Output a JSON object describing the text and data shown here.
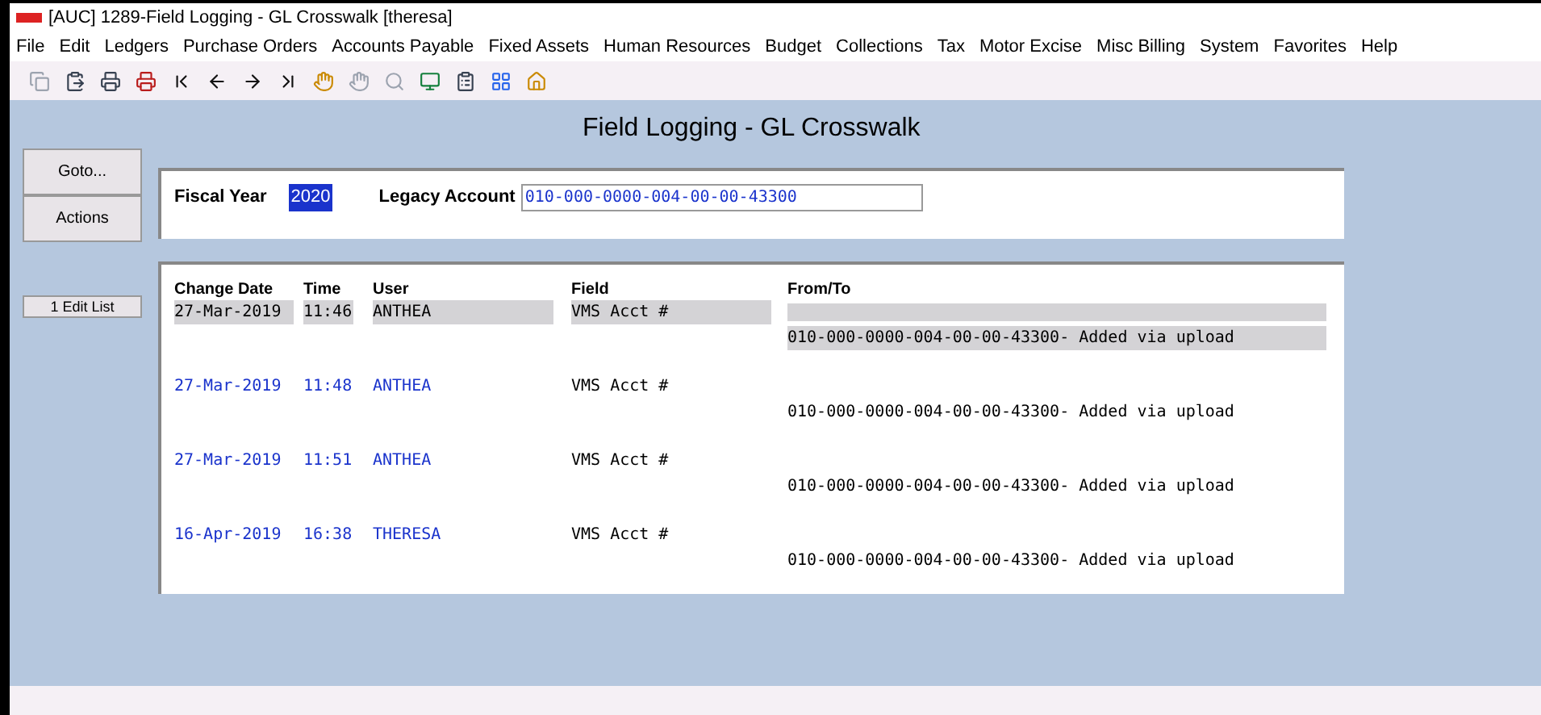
{
  "window": {
    "title": "[AUC] 1289-Field Logging - GL Crosswalk [theresa]"
  },
  "menu": [
    "File",
    "Edit",
    "Ledgers",
    "Purchase Orders",
    "Accounts Payable",
    "Fixed Assets",
    "Human Resources",
    "Budget",
    "Collections",
    "Tax",
    "Motor Excise",
    "Misc Billing",
    "System",
    "Favorites",
    "Help"
  ],
  "page_title": "Field Logging - GL Crosswalk",
  "side_buttons": [
    "Goto...",
    "Actions"
  ],
  "edit_list_button": "1 Edit List",
  "filters": {
    "fiscal_year_label": "Fiscal Year",
    "fiscal_year": "2020",
    "legacy_account_label": "Legacy Account",
    "legacy_account": "010-000-0000-004-00-00-43300"
  },
  "table": {
    "columns": [
      "Change Date",
      "Time",
      "User",
      "Field",
      "From/To"
    ],
    "rows": [
      {
        "date": "27-Mar-2019",
        "time": "11:46",
        "user": "ANTHEA",
        "field": "VMS Acct #",
        "to": "010-000-0000-004-00-00-43300- Added via upload",
        "selected": true
      },
      {
        "date": "27-Mar-2019",
        "time": "11:48",
        "user": "ANTHEA",
        "field": "VMS Acct #",
        "to": "010-000-0000-004-00-00-43300- Added via upload",
        "selected": false
      },
      {
        "date": "27-Mar-2019",
        "time": "11:51",
        "user": "ANTHEA",
        "field": "VMS Acct #",
        "to": "010-000-0000-004-00-00-43300- Added via upload",
        "selected": false
      },
      {
        "date": "16-Apr-2019",
        "time": "16:38",
        "user": "THERESA",
        "field": "VMS Acct #",
        "to": "010-000-0000-004-00-00-43300- Added via upload",
        "selected": false
      }
    ]
  }
}
